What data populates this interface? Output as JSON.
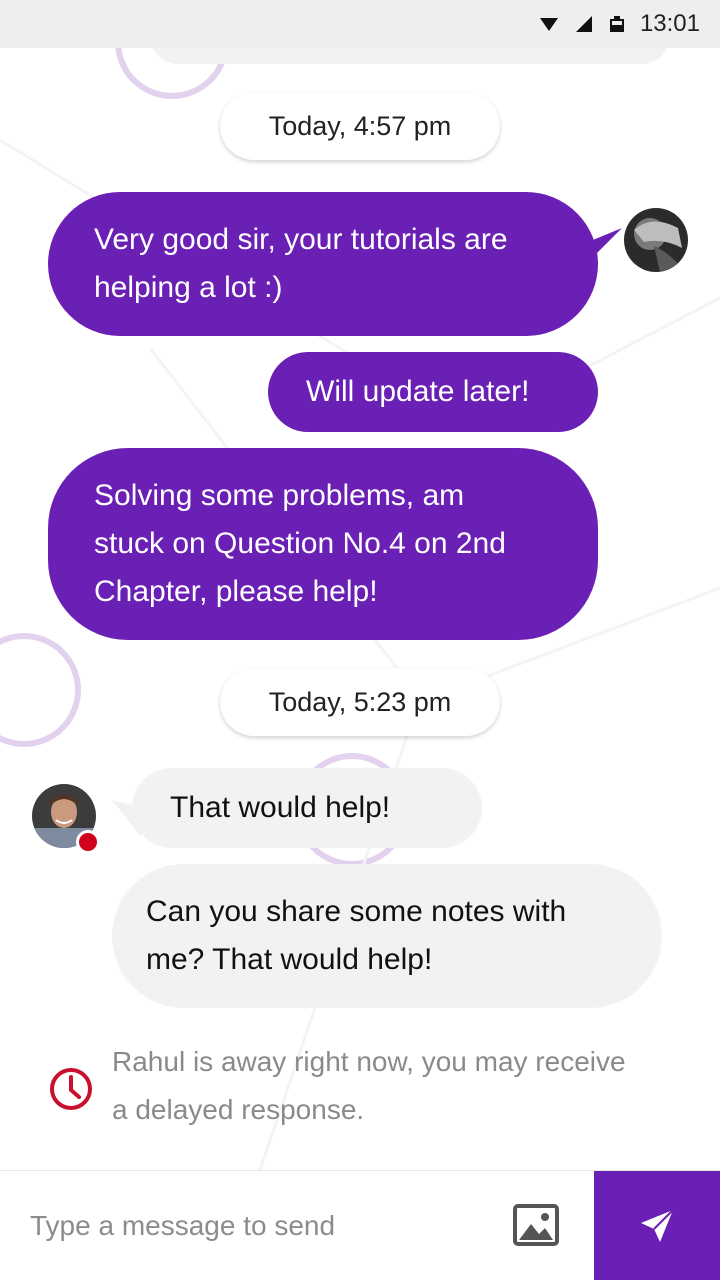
{
  "status_bar": {
    "time": "13:01",
    "icons": [
      "wifi-icon",
      "cell-signal-icon",
      "battery-icon"
    ]
  },
  "conversation": {
    "dates": [
      "Today, 4:57 pm",
      "Today, 5:23 pm"
    ],
    "outgoing": [
      {
        "text_lines": [
          "Very good sir, your tutorials are",
          "helping a lot :)"
        ]
      },
      {
        "text_lines": [
          "Will update later!"
        ]
      },
      {
        "text_lines": [
          "Solving some problems, am",
          "stuck on Question No.4 on 2nd",
          "Chapter, please help!"
        ]
      }
    ],
    "incoming": [
      {
        "text_lines": [
          "That would help!"
        ]
      },
      {
        "text_lines": [
          "Can you share some notes with",
          "me? That would help!"
        ]
      }
    ],
    "contact_status": "offline"
  },
  "away_notice": {
    "lines": [
      "Rahul is away right now, you may receive",
      "a delayed response."
    ]
  },
  "composer": {
    "placeholder": "Type a message to send",
    "value": ""
  },
  "colors": {
    "accent": "#6a1fb5",
    "incoming_bubble": "#f2f2f2",
    "status_bar": "#eeeeee",
    "away_icon": "#c8102e",
    "presence_offline": "#d0021b"
  }
}
